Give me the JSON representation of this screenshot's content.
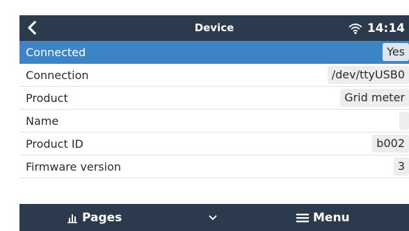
{
  "topbar": {
    "title": "Device",
    "time": "14:14",
    "back_icon": "chevron-left-icon",
    "wifi_icon": "wifi-icon"
  },
  "rows": [
    {
      "label": "Connected",
      "value": "Yes"
    },
    {
      "label": "Connection",
      "value": "/dev/ttyUSB0"
    },
    {
      "label": "Product",
      "value": "Grid meter"
    },
    {
      "label": "Name",
      "value": ""
    },
    {
      "label": "Product ID",
      "value": "b002"
    },
    {
      "label": "Firmware version",
      "value": "3"
    }
  ],
  "bottombar": {
    "pages_label": "Pages",
    "menu_label": "Menu",
    "pages_icon": "bar-chart-icon",
    "down_icon": "chevron-down-icon",
    "menu_icon": "hamburger-icon"
  },
  "colors": {
    "bar": "#2b3a4c",
    "selected": "#3c84c6",
    "value_bg": "#eceded"
  }
}
